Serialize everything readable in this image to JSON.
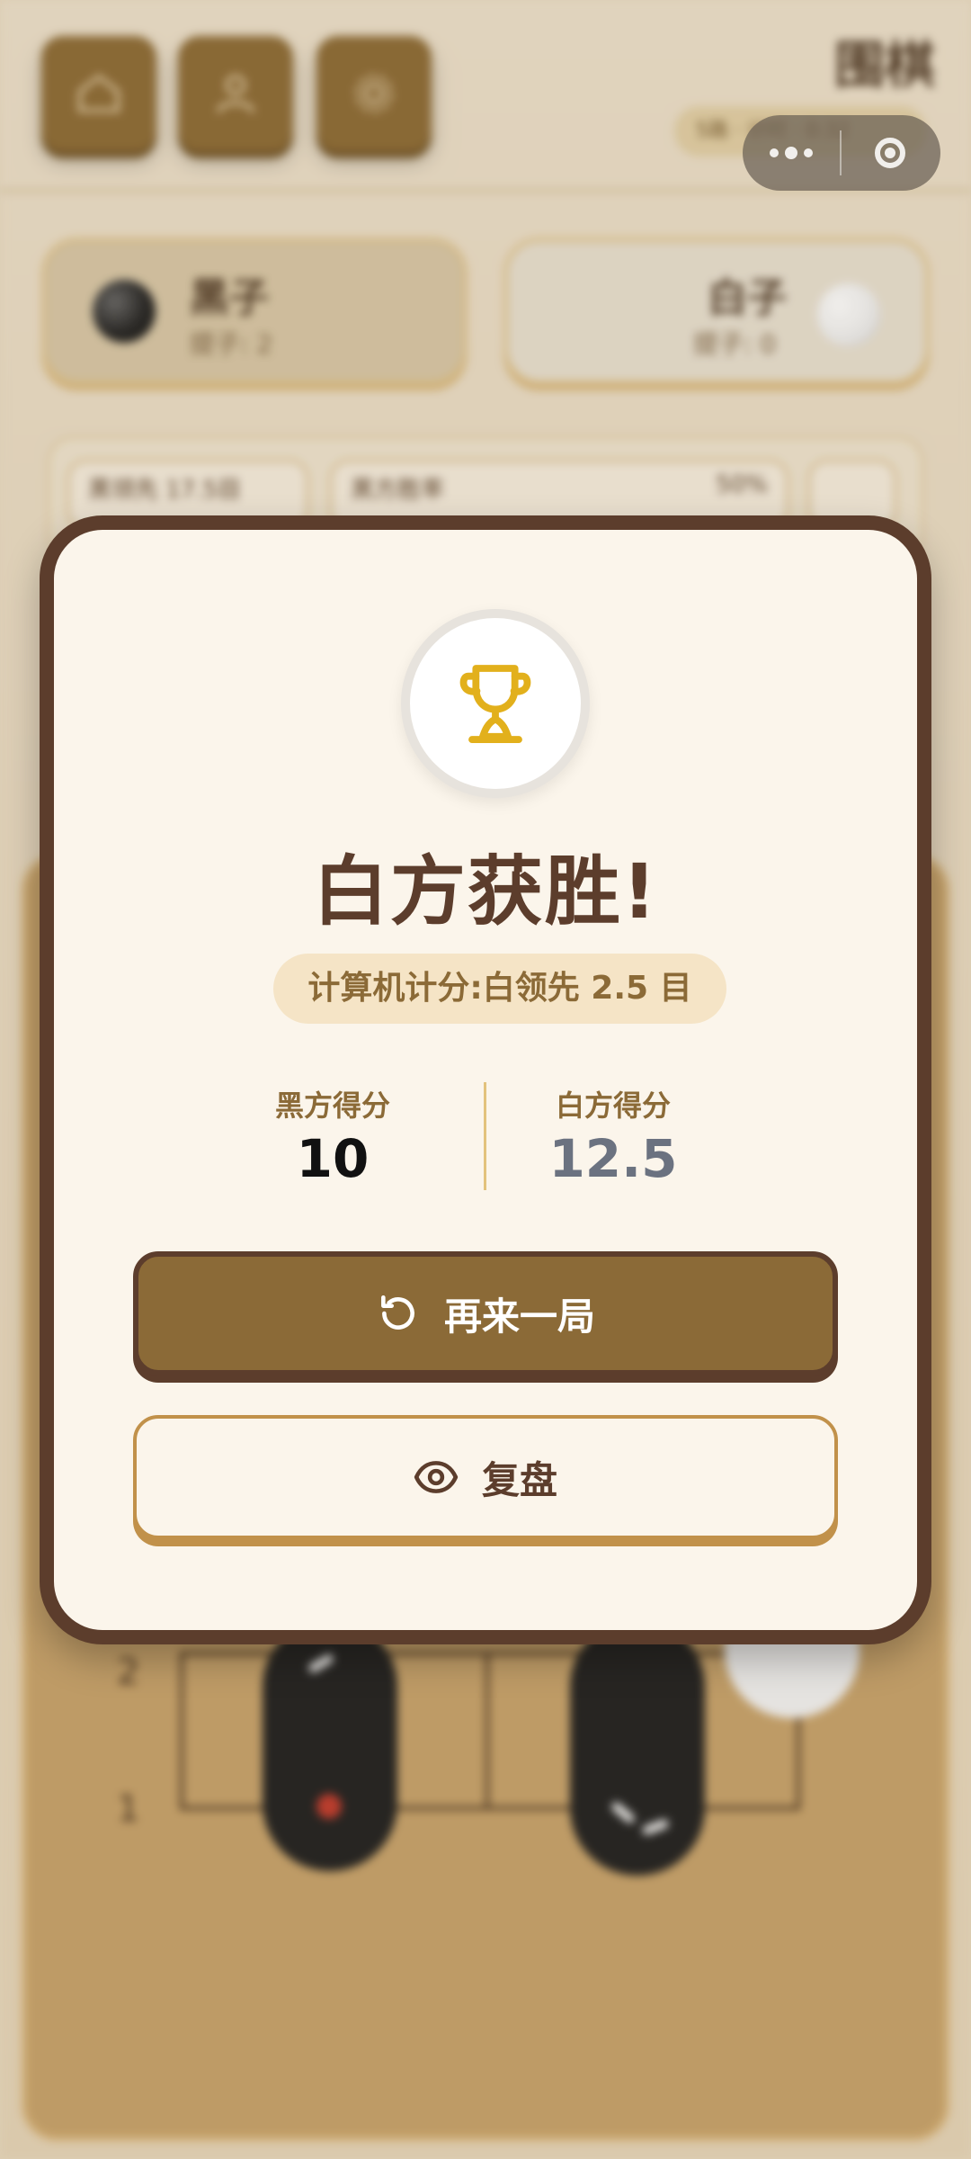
{
  "app": {
    "title": "围棋"
  },
  "header": {
    "pill_text": "5路 · 计时 · 0:32"
  },
  "players": {
    "black": {
      "name": "黑子",
      "captures": "提子: 2"
    },
    "white": {
      "name": "白子",
      "captures": "提子: 0"
    }
  },
  "info": {
    "lead": "黑领先 17.5目",
    "winrate_label": "黑方胜率",
    "winrate_value": "50%"
  },
  "board": {
    "row_labels": [
      "2",
      "1"
    ]
  },
  "modal": {
    "title": "白方获胜!",
    "score_note": "计算机计分:白领先 2.5 目",
    "black_label": "黑方得分",
    "black_score": "10",
    "white_label": "白方得分",
    "white_score": "12.5",
    "again_label": "再来一局",
    "review_label": "复盘"
  },
  "colors": {
    "primary_brown": "#8b6a37",
    "dark_brown": "#5c3d2c",
    "trophy_gold": "#e2b01c",
    "white_score": "#6b7280",
    "modal_bg": "#fbf5eb"
  },
  "icons": {
    "home": "home-icon",
    "profile": "user-icon",
    "settings": "gear-icon",
    "trophy": "trophy-icon",
    "again": "refresh-icon",
    "review": "eye-icon"
  }
}
